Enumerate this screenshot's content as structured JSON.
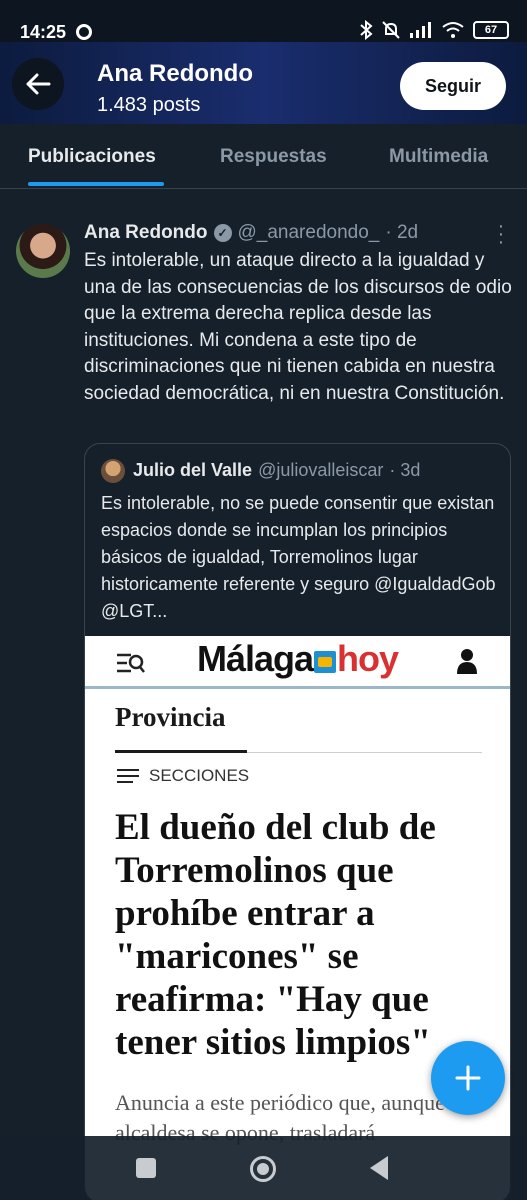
{
  "status_bar": {
    "time": "14:25",
    "battery": "67"
  },
  "header": {
    "name": "Ana Redondo",
    "posts": "1.483 posts",
    "follow_label": "Seguir"
  },
  "tabs": [
    {
      "label": "Publicaciones",
      "active": true
    },
    {
      "label": "Respuestas",
      "active": false
    },
    {
      "label": "Multimedia",
      "active": false
    }
  ],
  "tweet": {
    "name": "Ana Redondo",
    "handle": "@_anaredondo_",
    "time": "· 2d",
    "text": "Es intolerable, un ataque directo a la igualdad y una de las consecuencias de los discursos de odio que la extrema derecha replica desde las instituciones. Mi condena a este tipo de discriminaciones que ni tienen cabida en nuestra sociedad democrática, ni en nuestra Constitución."
  },
  "quote": {
    "name": "Julio del Valle",
    "handle": "@juliovalleiscar",
    "time": "· 3d",
    "text": "Es intolerable, no se puede consentir que existan espacios donde se incumplan los principios básicos de igualdad, Torremolinos lugar historicamente referente y seguro  @IgualdadGob @LGT..."
  },
  "article": {
    "logo_left": "Málaga",
    "logo_right": "hoy",
    "section": "Provincia",
    "secciones": "SECCIONES",
    "headline": "El dueño del club de Torremolinos que prohíbe entrar a \"maricones\" se reafirma: \"Hay que tener sitios limpios\"",
    "lead": "Anuncia a este periódico que, aunque la alcaldesa se opone, trasladará"
  },
  "colors": {
    "background": "#15202b",
    "accent": "#1d9bf0",
    "text_secondary": "#8b98a5"
  },
  "icons": {
    "back": "arrow-left-icon",
    "verified": "verified-badge-icon",
    "more": "more-vertical-icon",
    "compose": "plus-icon"
  }
}
